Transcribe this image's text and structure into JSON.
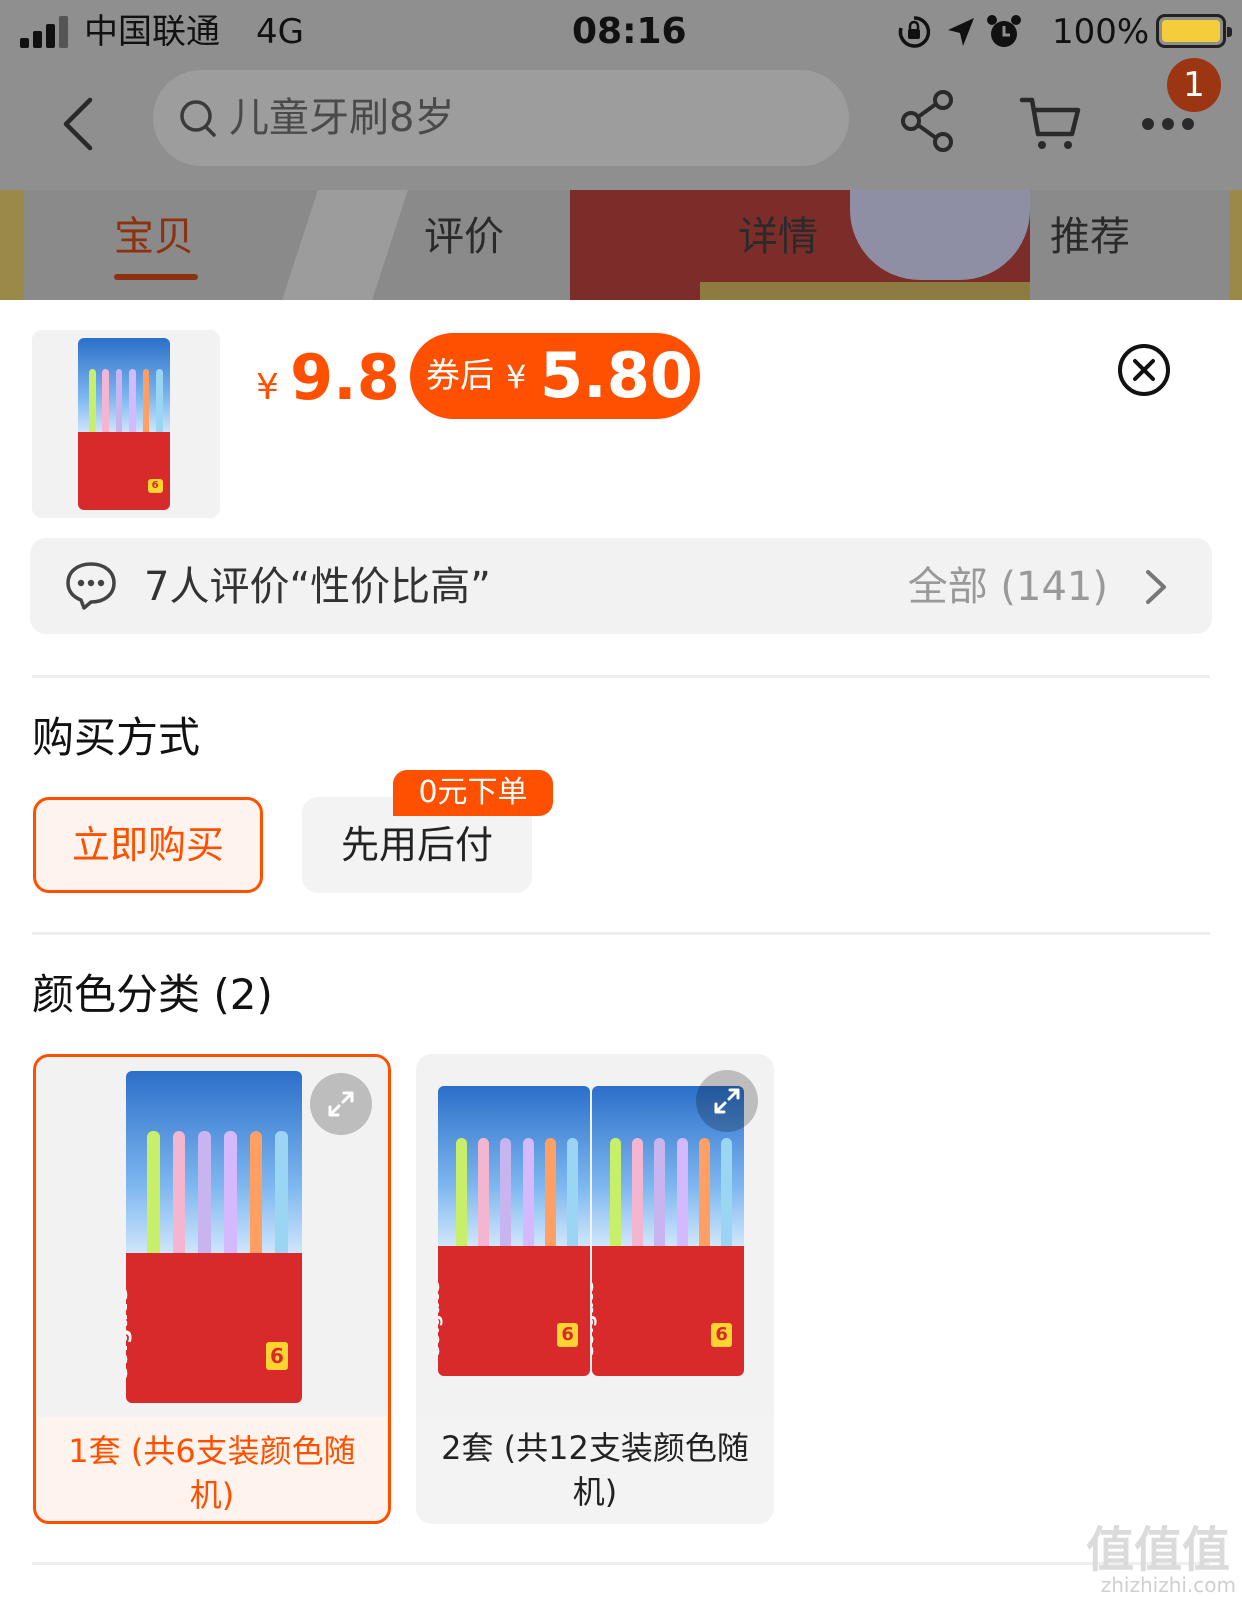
{
  "status_bar": {
    "carrier": "中国联通",
    "network": "4G",
    "time": "08:16",
    "battery": "100%"
  },
  "nav": {
    "search_text": "儿童牙刷8岁",
    "cart_badge": "1",
    "icons": [
      "chevron-left-icon",
      "search-icon",
      "share-icon",
      "cart-icon",
      "more-icon"
    ]
  },
  "tabs": [
    {
      "label": "宝贝",
      "active": true
    },
    {
      "label": "评价",
      "active": false
    },
    {
      "label": "详情",
      "active": false
    },
    {
      "label": "推荐",
      "active": false
    }
  ],
  "product": {
    "price_currency": "¥",
    "price": "9.8",
    "coupon_label": "券后",
    "coupon_currency": "¥",
    "coupon_price": "5.80"
  },
  "review": {
    "summary": "7人评价“性价比高”",
    "all_label": "全部 (141)"
  },
  "purchase": {
    "title": "购买方式",
    "options": [
      {
        "label": "立即购买",
        "selected": true
      },
      {
        "label": "先用后付",
        "selected": false,
        "badge": "0元下单"
      }
    ]
  },
  "colors": {
    "title": "颜色分类 (2)",
    "options": [
      {
        "label": "1套 (共6支装颜色随机)",
        "selected": true
      },
      {
        "label": "2套 (共12支装颜色随机)",
        "selected": false
      }
    ]
  },
  "watermark": {
    "main": "值值值",
    "sub": "zhizhizhi.com"
  },
  "theme": {
    "accent": "#ff5000",
    "overlay": "#8f8f8f",
    "panel_bg": "#f3f3f3"
  }
}
